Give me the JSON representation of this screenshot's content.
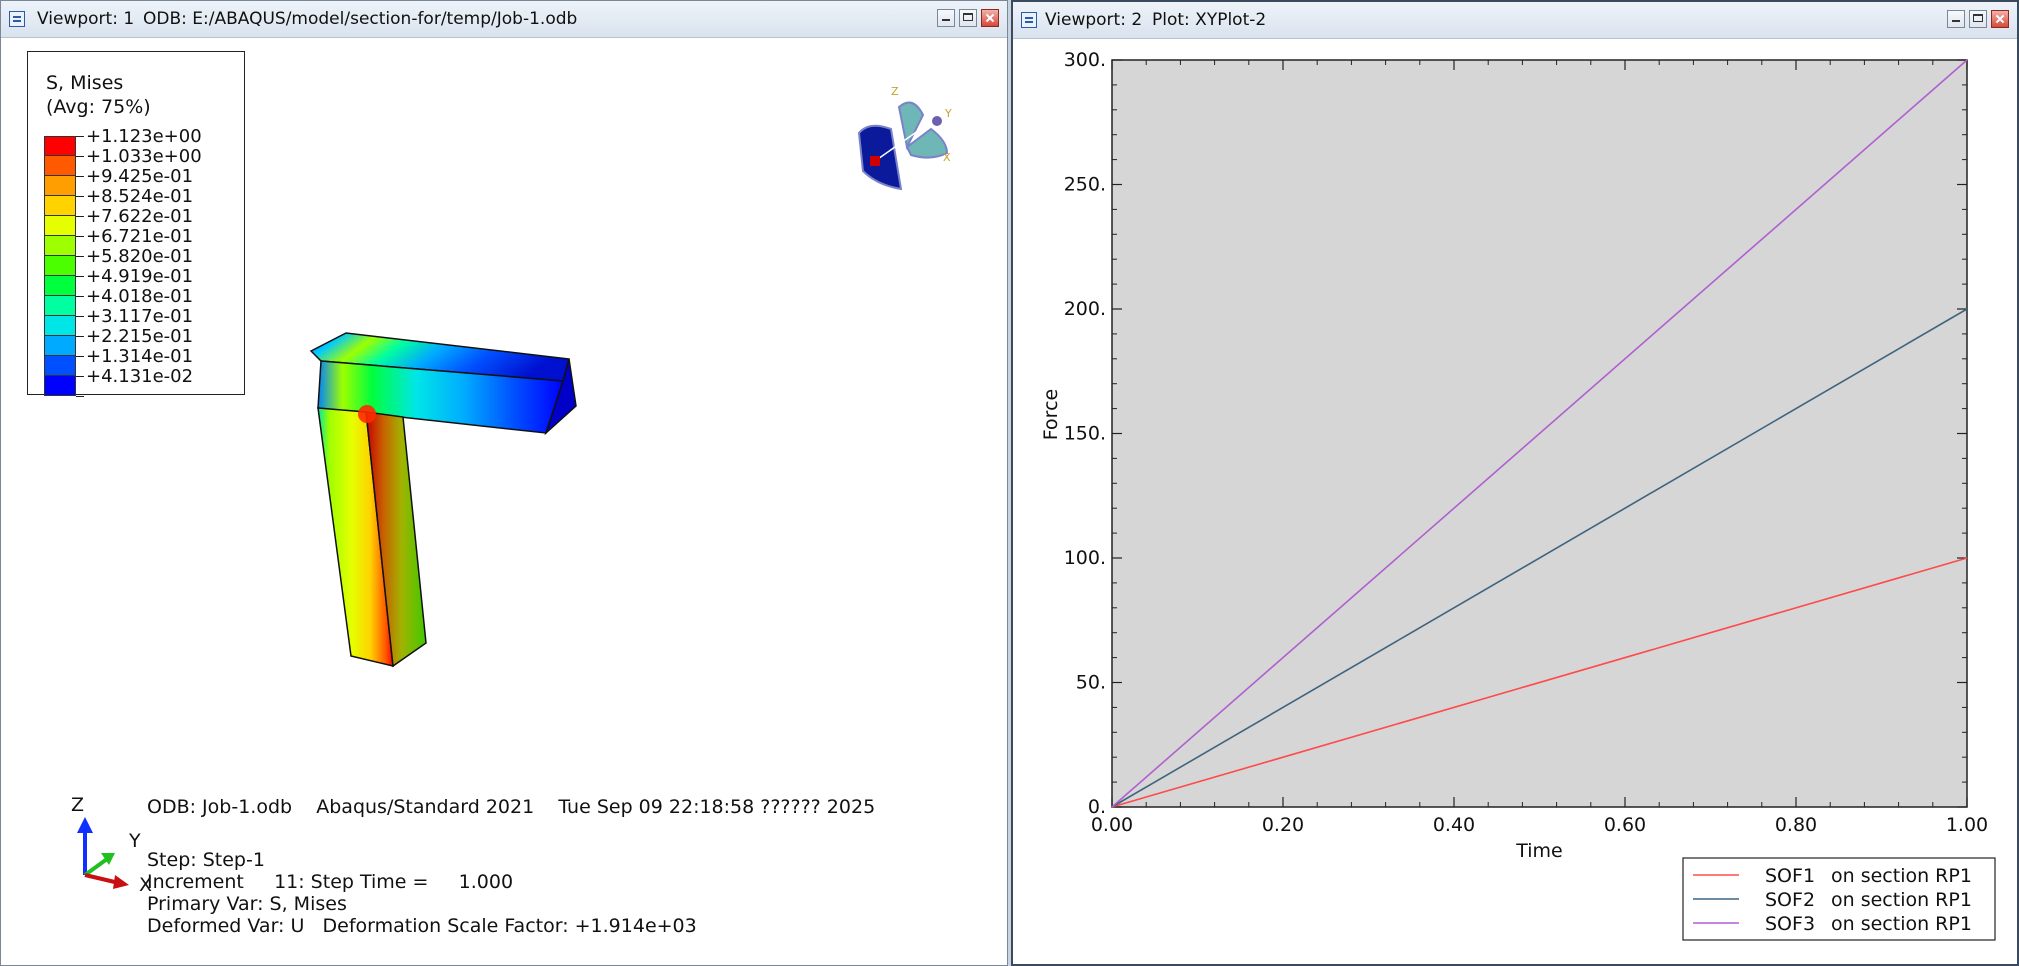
{
  "viewport1": {
    "title_label": "Viewport: 1",
    "title_path": "ODB: E:/ABAQUS/model/section-for/temp/Job-1.odb",
    "legend": {
      "title": "S, Mises",
      "subtitle": "(Avg: 75%)",
      "entries": [
        {
          "value": "+1.123e+00",
          "color": "#ff0000"
        },
        {
          "value": "+1.033e+00",
          "color": "#ff5a00"
        },
        {
          "value": "+9.425e-01",
          "color": "#ff9e00"
        },
        {
          "value": "+8.524e-01",
          "color": "#ffd200"
        },
        {
          "value": "+7.622e-01",
          "color": "#e6ff00"
        },
        {
          "value": "+6.721e-01",
          "color": "#9eff00"
        },
        {
          "value": "+5.820e-01",
          "color": "#4bff00"
        },
        {
          "value": "+4.919e-01",
          "color": "#00ff3c"
        },
        {
          "value": "+4.018e-01",
          "color": "#00ffa0"
        },
        {
          "value": "+3.117e-01",
          "color": "#00e6e6"
        },
        {
          "value": "+2.215e-01",
          "color": "#00aaff"
        },
        {
          "value": "+1.314e-01",
          "color": "#0050ff"
        },
        {
          "value": "+4.131e-02",
          "color": "#0000ff"
        }
      ]
    },
    "triad_small": {
      "z": "Z",
      "y": "Y",
      "x": "X"
    },
    "triad_axes": {
      "z": "Z",
      "y": "Y",
      "x": "X"
    },
    "info": {
      "line1": "ODB: Job-1.odb    Abaqus/Standard 2021    Tue Sep 09 22:18:58 ?????? 2025",
      "step": "Step: Step-1",
      "increment": "Increment     11: Step Time =     1.000",
      "primary": "Primary Var: S, Mises",
      "deformed": "Deformed Var: U   Deformation Scale Factor: +1.914e+03"
    }
  },
  "viewport2": {
    "title_label": "Viewport: 2",
    "title_plot": "Plot: XYPlot-2",
    "legend_entries": [
      {
        "name": "SOF1",
        "desc": "on section RP1",
        "color": "#ff4a4a"
      },
      {
        "name": "SOF2",
        "desc": "on section RP1",
        "color": "#3f6480"
      },
      {
        "name": "SOF3",
        "desc": "on section RP1",
        "color": "#b05fd0"
      }
    ]
  },
  "chart_data": {
    "type": "line",
    "xlabel": "Time",
    "ylabel": "Force",
    "xlim": [
      0,
      1
    ],
    "ylim": [
      0,
      300
    ],
    "xticks": [
      "0.00",
      "0.20",
      "0.40",
      "0.60",
      "0.80",
      "1.00"
    ],
    "yticks": [
      "0.",
      "50.",
      "100.",
      "150.",
      "200.",
      "250.",
      "300."
    ],
    "background": "#d6d6d6",
    "series": [
      {
        "name": "SOF1  on section RP1",
        "color": "#ff4a4a",
        "x": [
          0,
          1
        ],
        "y": [
          0,
          100
        ]
      },
      {
        "name": "SOF2  on section RP1",
        "color": "#3f6480",
        "x": [
          0,
          1
        ],
        "y": [
          0,
          200
        ]
      },
      {
        "name": "SOF3  on section RP1",
        "color": "#b05fd0",
        "x": [
          0,
          1
        ],
        "y": [
          0,
          300
        ]
      }
    ]
  }
}
